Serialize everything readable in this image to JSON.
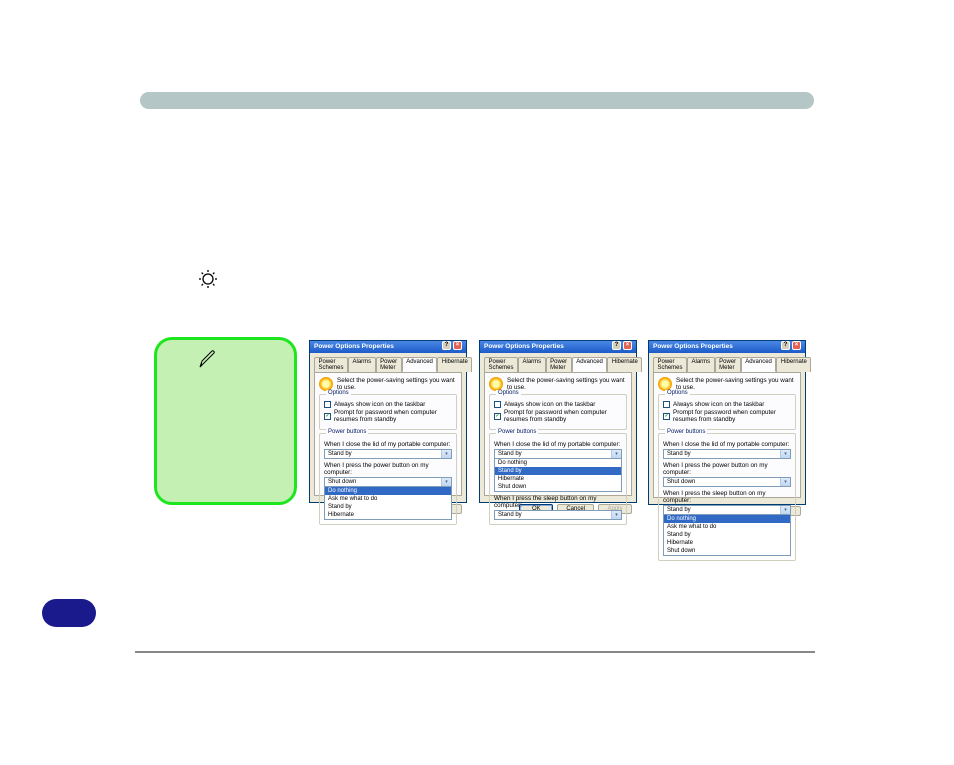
{
  "dialog_title": "Power Options Properties",
  "tabs": [
    "Power Schemes",
    "Alarms",
    "Power Meter",
    "Advanced",
    "Hibernate"
  ],
  "active_tab_index": 3,
  "instruction": "Select the power-saving settings you want to use.",
  "group_options_title": "Options",
  "chk_taskbar": "Always show icon on the taskbar",
  "chk_password": "Prompt for password when computer resumes from standby",
  "group_power_title": "Power buttons",
  "q_lid": "When I close the lid of my portable computer:",
  "q_power": "When I press the power button on my computer:",
  "q_sleep": "When I press the sleep button on my computer:",
  "val_standby": "Stand by",
  "val_shutdown": "Shut down",
  "power_options": [
    "Do nothing",
    "Ask me what to do",
    "Stand by",
    "Hibernate"
  ],
  "power_options_full": [
    "Do nothing",
    "Ask me what to do",
    "Stand by",
    "Hibernate",
    "Shut down"
  ],
  "lid_options": [
    "Do nothing",
    "Stand by",
    "Hibernate",
    "Shut down"
  ],
  "btn_ok": "OK",
  "btn_cancel": "Cancel",
  "btn_apply": "Apply",
  "dlg1": {
    "chk_taskbar": false,
    "chk_password": true,
    "lid_val": "Stand by",
    "power_val": "Shut down",
    "open_dropdown": "power"
  },
  "dlg2": {
    "chk_taskbar": false,
    "chk_password": true,
    "lid_val": "Stand by",
    "open_dropdown": "lid",
    "sleep_val": "Stand by"
  },
  "dlg3": {
    "chk_taskbar": false,
    "chk_password": true,
    "lid_val": "Stand by",
    "power_val": "Shut down",
    "sleep_val": "Stand by",
    "open_dropdown": "sleep"
  }
}
